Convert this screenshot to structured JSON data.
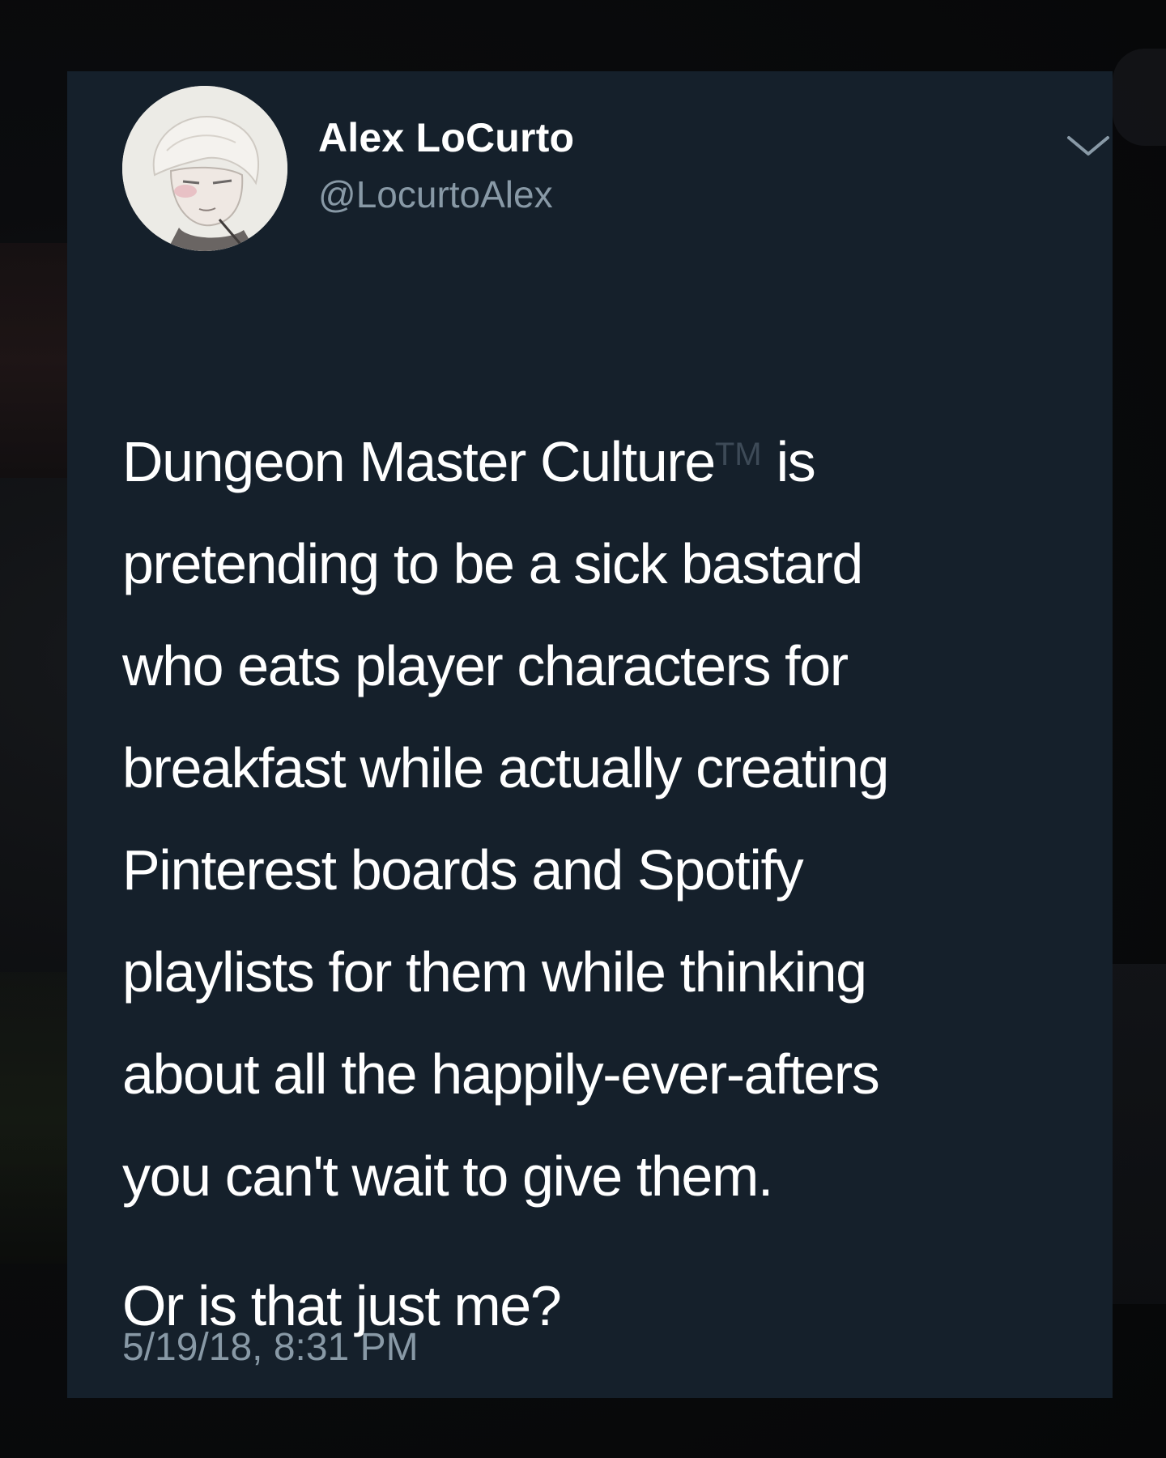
{
  "colors": {
    "background": "#0a0b0d",
    "card": "#15202b",
    "text": "#ffffff",
    "muted": "#8899a6"
  },
  "tweet": {
    "author": {
      "display_name": "Alex LoCurto",
      "handle": "@LocurtoAlex",
      "avatar_icon": "avatar-sketch"
    },
    "menu_icon": "chevron-down-icon",
    "body": {
      "line1_before_tm": "Dungeon Master Culture",
      "tm_mark": "TM",
      "line1_after_tm": " is",
      "rest": "pretending to be a sick bastard\nwho eats player characters for\nbreakfast while actually creating\nPinterest boards and Spotify\nplaylists for them while thinking\nabout all the happily-ever-afters\nyou can't wait to give them.",
      "paragraph2": "Or is that just me?"
    },
    "timestamp": "5/19/18, 8:31 PM"
  }
}
